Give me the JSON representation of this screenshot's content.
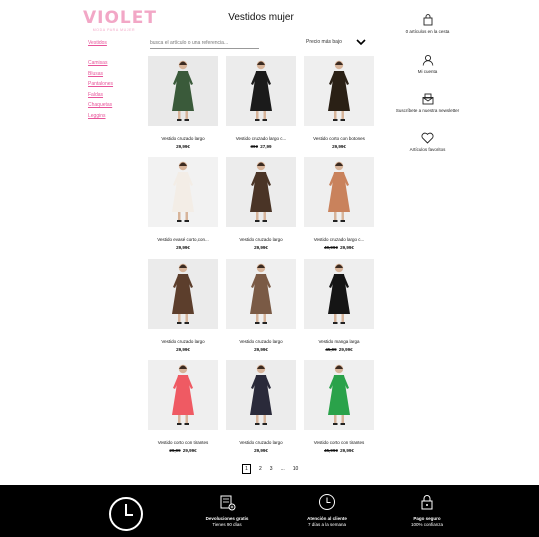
{
  "brand": {
    "logo_text": "VIOLET",
    "tagline": "MODA PARA MUJER",
    "color": "#f2a7c6"
  },
  "page_title": "Vestidos mujer",
  "sidebar": {
    "main": "Vestidos",
    "items": [
      "Camisas",
      "Blusas",
      "Pantalones",
      "Faldas",
      "Chaquetas",
      "Leggins"
    ]
  },
  "search": {
    "placeholder": "busca el artículo o una referencia..."
  },
  "sort": {
    "label": "Precio más bajo"
  },
  "products": [
    {
      "name": "Vestido cruzado largo",
      "old_price": "",
      "price": "29,99€",
      "dress_color": "#3a5a3a",
      "bg": "#e9e9e9"
    },
    {
      "name": "Vestido cruzado largo c...",
      "old_price": "30€",
      "price": "27,99",
      "dress_color": "#1b1b1b",
      "bg": "#ececec"
    },
    {
      "name": "Vestido corto con botones",
      "old_price": "",
      "price": "29,99€",
      "dress_color": "#2a2015",
      "bg": "#efefef"
    },
    {
      "name": "Vestido evasé corto,con...",
      "old_price": "",
      "price": "29,99€",
      "dress_color": "#f3ede6",
      "bg": "#f2f2f2"
    },
    {
      "name": "Vestido cruzado largo",
      "old_price": "",
      "price": "29,99€",
      "dress_color": "#4a3426",
      "bg": "#ececec"
    },
    {
      "name": "Vestido cruzado largo c...",
      "old_price": "49,99€",
      "price": "29,99€",
      "dress_color": "#c9825c",
      "bg": "#efefef"
    },
    {
      "name": "Vestido cruzado largo",
      "old_price": "",
      "price": "29,99€",
      "dress_color": "#5c3e2c",
      "bg": "#ebebeb"
    },
    {
      "name": "Vestido cruzado largo",
      "old_price": "",
      "price": "29,99€",
      "dress_color": "#7a5a45",
      "bg": "#efefef"
    },
    {
      "name": "Vestido manga larga",
      "old_price": "45,99",
      "price": "29,99€",
      "dress_color": "#151515",
      "bg": "#eeeeee"
    },
    {
      "name": "Vestido corto con tirantes",
      "old_price": "29,99",
      "price": "29,99€",
      "dress_color": "#ef5a63",
      "bg": "#efefef"
    },
    {
      "name": "Vestido cruzado largo",
      "old_price": "",
      "price": "29,99€",
      "dress_color": "#2a2a3a",
      "bg": "#ececec"
    },
    {
      "name": "Vestido corto con tirantes",
      "old_price": "45,99€",
      "price": "29,99€",
      "dress_color": "#2aa24a",
      "bg": "#efefef"
    }
  ],
  "right_panel": {
    "cart": "0 artículos en la cesta",
    "account": "Mi cuenta",
    "newsletter": "Suscríbete a nuestra newsletter",
    "favorites": "Artículos favoritos"
  },
  "pagination": {
    "pages": [
      "1",
      "2",
      "3",
      "...",
      "10"
    ],
    "active": "1"
  },
  "footer": {
    "returns_title": "Devoluciones gratis",
    "returns_sub": "Tienes 90 días",
    "support_title": "Atención al cliente",
    "support_sub": "7 días a la semana",
    "payment_title": "Pago seguro",
    "payment_sub": "100% confianza"
  }
}
